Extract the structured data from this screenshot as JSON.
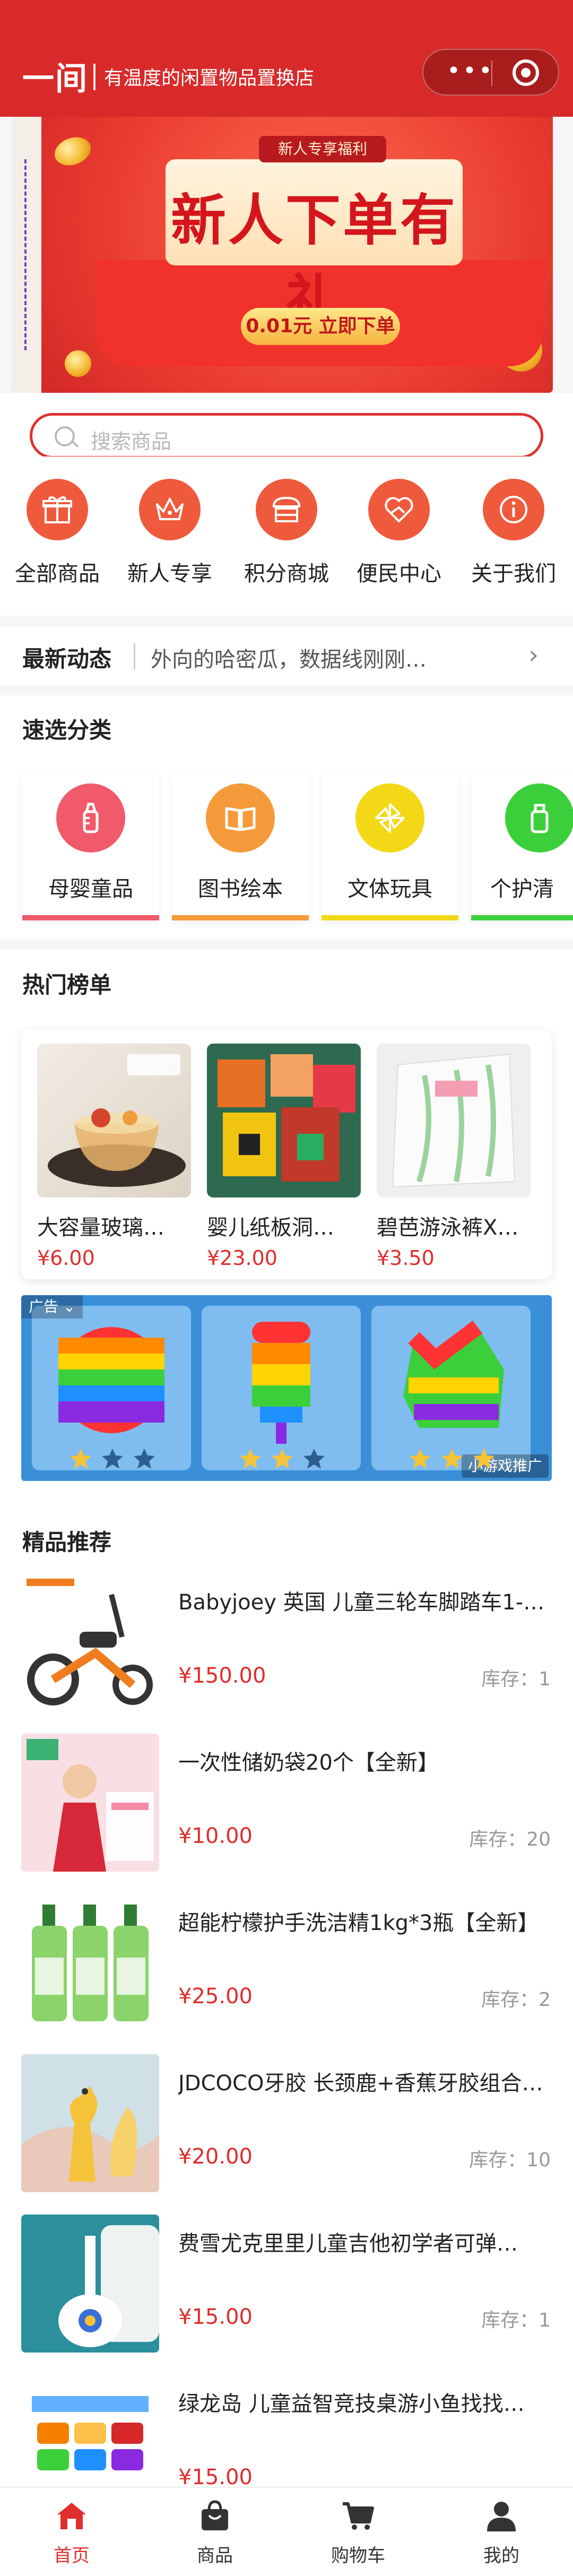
{
  "header": {
    "brand": "一间",
    "slogan": "有温度的闲置物品置换店"
  },
  "banner": {
    "tag": "新人专享福利",
    "headline": "新人下单有礼",
    "cta": "0.01元 立即下单"
  },
  "search": {
    "placeholder": "搜索商品"
  },
  "shortcuts": [
    {
      "label": "全部商品",
      "icon": "gift-icon"
    },
    {
      "label": "新人专享",
      "icon": "crown-icon"
    },
    {
      "label": "积分商城",
      "icon": "shop-icon"
    },
    {
      "label": "便民中心",
      "icon": "heart-hand-icon"
    },
    {
      "label": "关于我们",
      "icon": "info-icon"
    }
  ],
  "news": {
    "label": "最新动态",
    "text": "外向的哈密瓜，数据线刚刚…"
  },
  "categories": {
    "title": "速选分类",
    "items": [
      {
        "label": "母婴童品",
        "icon": "baby-bottle-icon",
        "color": "#f05a6a"
      },
      {
        "label": "图书绘本",
        "icon": "book-icon",
        "color": "#f49a3a"
      },
      {
        "label": "文体玩具",
        "icon": "pinwheel-icon",
        "color": "#f3d817"
      },
      {
        "label": "个护清",
        "icon": "bottle-icon",
        "color": "#3ccf3c"
      }
    ]
  },
  "hot": {
    "title": "热门榜单",
    "items": [
      {
        "name": "大容量玻璃…",
        "price": "¥6.00"
      },
      {
        "name": "婴儿纸板洞…",
        "price": "¥23.00"
      },
      {
        "name": "碧芭游泳裤X…",
        "price": "¥3.50"
      }
    ]
  },
  "ad": {
    "badge": "广告",
    "footer": "小游戏推广"
  },
  "recommend": {
    "title": "精品推荐",
    "items": [
      {
        "name": "Babyjoey 英国 儿童三轮车脚踏车1-…",
        "price": "¥150.00",
        "stock": "库存：1"
      },
      {
        "name": "一次性储奶袋20个【全新】",
        "price": "¥10.00",
        "stock": "库存：20"
      },
      {
        "name": "超能柠檬护手洗洁精1kg*3瓶【全新】",
        "price": "¥25.00",
        "stock": "库存：2"
      },
      {
        "name": "JDCOCO牙胶 长颈鹿+香蕉牙胶组合…",
        "price": "¥20.00",
        "stock": "库存：10"
      },
      {
        "name": "费雪尤克里里儿童吉他初学者可弹…",
        "price": "¥15.00",
        "stock": "库存：1"
      },
      {
        "name": "绿龙岛 儿童益智竞技桌游小鱼找找…",
        "price": "¥15.00",
        "stock": ""
      }
    ]
  },
  "tabbar": [
    {
      "label": "首页",
      "icon": "home-icon",
      "active": true
    },
    {
      "label": "商品",
      "icon": "bag-icon",
      "active": false
    },
    {
      "label": "购物车",
      "icon": "cart-icon",
      "active": false
    },
    {
      "label": "我的",
      "icon": "user-icon",
      "active": false
    }
  ],
  "colors": {
    "brand_red": "#d92a2a",
    "price_red": "#e02d2d",
    "icon_orange": "#f05a3c"
  }
}
